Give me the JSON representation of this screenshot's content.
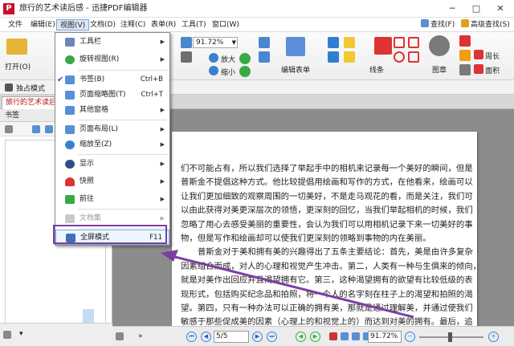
{
  "window": {
    "title": "旅行的艺术读后感 - 迅捷PDF编辑器"
  },
  "menubar": {
    "items": [
      "文件",
      "编辑(E)",
      "视图(V)",
      "文档(D)",
      "注释(C)",
      "表单(R)",
      "工具(T)",
      "窗口(W)"
    ],
    "active_index": 2,
    "right_items": [
      "查找(F)",
      "高级查找(S)"
    ]
  },
  "ribbon": {
    "open_label": "打开(O)",
    "zoom_value": "91.72%",
    "zoom_in_label": "放大",
    "zoom_out_label": "缩小",
    "edit_form_label": "编辑表单",
    "line_label": "线条",
    "stamp_label": "图章",
    "perimeter_label": "周长",
    "area_label": "面积"
  },
  "toolbar2": {
    "exclusive_mode_label": "独占模式"
  },
  "tabs": {
    "document_tab": "旅行的艺术读后感"
  },
  "bookmark_panel": {
    "title": "书签"
  },
  "view_menu": {
    "items": [
      {
        "label": "工具栏",
        "shortcut": "",
        "submenu": true,
        "checked": false,
        "disabled": false
      },
      {
        "label": "旋转视图(R)",
        "shortcut": "",
        "submenu": true,
        "checked": false,
        "disabled": false
      },
      {
        "label": "书签(B)",
        "shortcut": "Ctrl+B",
        "submenu": false,
        "checked": true,
        "disabled": false
      },
      {
        "label": "页面缩略图(T)",
        "shortcut": "Ctrl+T",
        "submenu": false,
        "checked": false,
        "disabled": false
      },
      {
        "label": "其他窗格",
        "shortcut": "",
        "submenu": true,
        "checked": false,
        "disabled": false
      },
      {
        "label": "页面布局(L)",
        "shortcut": "",
        "submenu": true,
        "checked": false,
        "disabled": false
      },
      {
        "label": "缩放至(Z)",
        "shortcut": "",
        "submenu": true,
        "checked": false,
        "disabled": false
      },
      {
        "label": "显示",
        "shortcut": "",
        "submenu": true,
        "checked": false,
        "disabled": false
      },
      {
        "label": "快照",
        "shortcut": "",
        "submenu": true,
        "checked": false,
        "disabled": false
      },
      {
        "label": "前往",
        "shortcut": "",
        "submenu": true,
        "checked": false,
        "disabled": false
      },
      {
        "label": "文档集",
        "shortcut": "",
        "submenu": true,
        "checked": false,
        "disabled": true
      },
      {
        "label": "全屏模式",
        "shortcut": "F11",
        "submenu": false,
        "checked": false,
        "disabled": false
      }
    ]
  },
  "document": {
    "lines": [
      {
        "text": "们不可能占有，所以我们选择了举起手中的相机来记录每一个美好的瞬间，但是",
        "indent": false
      },
      {
        "text": "普斯金不提倡这种方式。他比较提倡用绘画和写作的方式，在他看来，绘画可以",
        "indent": false
      },
      {
        "text": "让我们更加细致的观察周围的一切美好，不是走马观花的看，而是关注，我们可",
        "indent": false
      },
      {
        "text": "以由此获得对美更深层次的领悟，更深刻的回忆，当我们举起相机的时候，我们",
        "indent": false
      },
      {
        "text": "忽略了用心去感受美丽的重要性，会认为我们可以用相机记录下来一切美好的事",
        "indent": false
      },
      {
        "text": "物，但是写作和绘画却可以使我们更深刻的领略到事物的内在美丽。",
        "indent": false
      },
      {
        "text": "普斯金对于美和拥有美的兴趣得出了五条主要结论：首先，美是由许多复杂",
        "indent": true
      },
      {
        "text": "因素组合而成，对人的心理和视觉产生冲击。第二，人类有一种与生俱来的倾向，",
        "indent": false
      },
      {
        "text": "就是对美作出回应并且渴望拥有它。第三，这种渴望拥有的欲望有比较低级的表",
        "indent": false
      },
      {
        "text": "现形式，包括购买纪念品和拍照，将一个人的名字刻在柱子上的渴望和拍照的渴",
        "indent": false
      },
      {
        "text": "望。第四，只有一种办法可以正确的拥有美，那就是通过理解美，并通过使我们",
        "indent": false
      },
      {
        "text": "敏感于那些促成美的因素（心理上的和视觉上的）而达到对美的拥有。最后，追",
        "indent": false
      },
      {
        "text": "求这种敏锐理解的最有效方式就是，尝试通过写文或绘画来描述美丽",
        "indent": false
      }
    ]
  },
  "statusbar": {
    "page_value": "5/5",
    "zoom_value": "91.72%"
  },
  "colors": {
    "menu_highlight_border": "#7b3fa2",
    "annotation_arrow": "#7b3fa2",
    "accent_blue": "#2a5ea8"
  }
}
